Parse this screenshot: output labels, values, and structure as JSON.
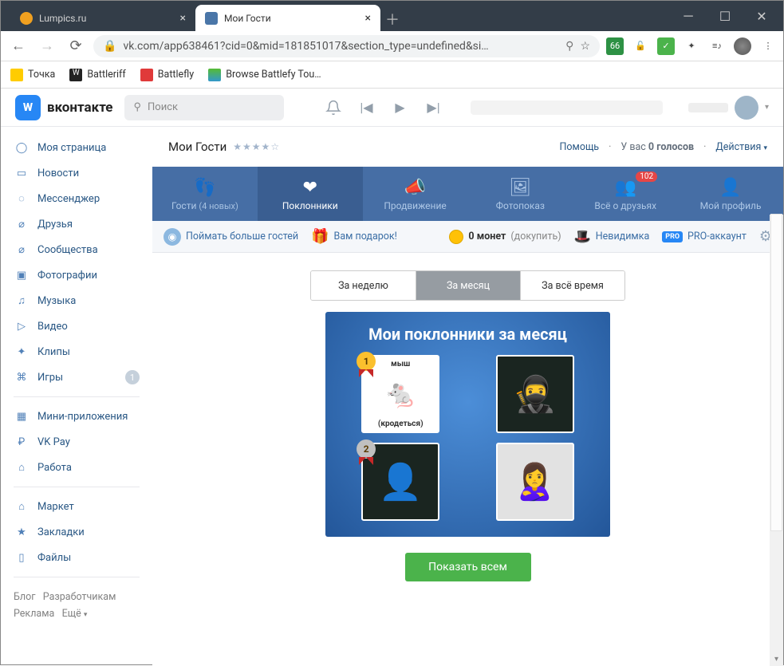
{
  "browser": {
    "tabs": [
      {
        "title": "Lumpics.ru",
        "active": false
      },
      {
        "title": "Мои Гости",
        "active": true
      }
    ],
    "url": "vk.com/app638461?cid=0&mid=181851017&section_type=undefined&si…",
    "bookmarks": [
      {
        "label": "Точка"
      },
      {
        "label": "Battleriff"
      },
      {
        "label": "Battlefly"
      },
      {
        "label": "Browse Battlefy Tou…"
      }
    ],
    "ext_badge": "66"
  },
  "vk": {
    "logo_text": "вконтакте",
    "search_placeholder": "Поиск",
    "nav": [
      {
        "label": "Моя страница",
        "icon": "◯"
      },
      {
        "label": "Новости",
        "icon": "▭"
      },
      {
        "label": "Мессенджер",
        "icon": "◌"
      },
      {
        "label": "Друзья",
        "icon": "⌀"
      },
      {
        "label": "Сообщества",
        "icon": "⌀"
      },
      {
        "label": "Фотографии",
        "icon": "▣"
      },
      {
        "label": "Музыка",
        "icon": "♫"
      },
      {
        "label": "Видео",
        "icon": "▷"
      },
      {
        "label": "Клипы",
        "icon": "✦"
      },
      {
        "label": "Игры",
        "icon": "⌘",
        "badge": "1"
      }
    ],
    "nav2": [
      {
        "label": "Мини-приложения",
        "icon": "▦"
      },
      {
        "label": "VK Pay",
        "icon": "₽"
      },
      {
        "label": "Работа",
        "icon": "⌂"
      }
    ],
    "nav3": [
      {
        "label": "Маркет",
        "icon": "⌂"
      },
      {
        "label": "Закладки",
        "icon": "★"
      },
      {
        "label": "Файлы",
        "icon": "▯"
      }
    ],
    "footer": {
      "l1a": "Блог",
      "l1b": "Разработчикам",
      "l2a": "Реклама",
      "l2b": "Ещё"
    }
  },
  "app": {
    "title": "Мои Гости",
    "help": "Помощь",
    "votes_prefix": "У вас ",
    "votes_count": "0 голосов",
    "actions": "Действия",
    "tabs": [
      {
        "label": "Гости",
        "sub": "(4 новых)"
      },
      {
        "label": "Поклонники"
      },
      {
        "label": "Продвижение"
      },
      {
        "label": "Фотопоказ"
      },
      {
        "label": "Всё о друзьях",
        "badge": "102"
      },
      {
        "label": "Мой профиль"
      }
    ],
    "toolbar": {
      "catch": "Поймать больше гостей",
      "gift": "Вам подарок!",
      "coins_count": "0 монет",
      "buy": "(докупить)",
      "invisible": "Невидимка",
      "pro": "PRO-аккаунт"
    },
    "periods": [
      {
        "label": "За неделю"
      },
      {
        "label": "За месяц",
        "active": true
      },
      {
        "label": "За всё время"
      }
    ],
    "fan_title": "Мои поклонники за месяц",
    "fan_item1_top": "мыш",
    "fan_item1_bottom": "(кродеться)",
    "medal1": "1",
    "medal2": "2",
    "show_all": "Показать всем"
  }
}
